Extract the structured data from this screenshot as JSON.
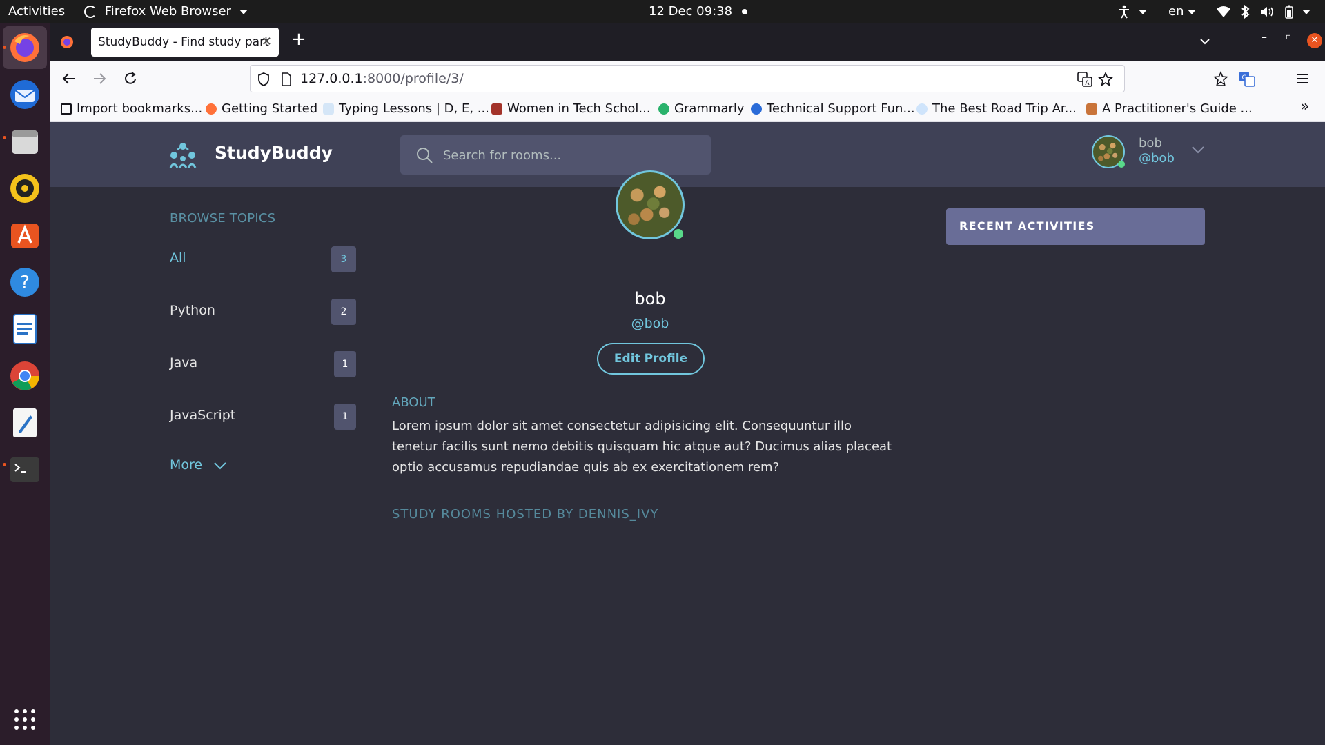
{
  "system_bar": {
    "activities": "Activities",
    "app_menu": "Firefox Web Browser",
    "clock": "12 Dec  09:38",
    "language": "en"
  },
  "browser": {
    "tab_title": "StudyBuddy - Find study part",
    "url_host": "127.0.0.1",
    "url_path": ":8000/profile/3/",
    "bookmarks": [
      {
        "label": "Import bookmarks...",
        "icon": "import-icon"
      },
      {
        "label": "Getting Started",
        "icon": "firefox-icon"
      },
      {
        "label": "Typing Lessons | D, E, ...",
        "icon": "typing-icon"
      },
      {
        "label": "Women in Tech Schol...",
        "icon": "shield-icon"
      },
      {
        "label": "Grammarly",
        "icon": "grammarly-icon"
      },
      {
        "label": "Technical Support Fun...",
        "icon": "c-icon"
      },
      {
        "label": "The Best Road Trip Ar...",
        "icon": "wifi-icon"
      },
      {
        "label": "A Practitioner's Guide ...",
        "icon": "person-icon"
      }
    ]
  },
  "app": {
    "brand": "StudyBuddy",
    "search_placeholder": "Search for rooms...",
    "user": {
      "name": "bob",
      "handle": "@bob"
    }
  },
  "sidebar": {
    "title": "BROWSE TOPICS",
    "topics": [
      {
        "label": "All",
        "count": "3"
      },
      {
        "label": "Python",
        "count": "2"
      },
      {
        "label": "Java",
        "count": "1"
      },
      {
        "label": "JavaScript",
        "count": "1"
      }
    ],
    "more": "More"
  },
  "profile": {
    "name": "bob",
    "handle": "@bob",
    "edit_label": "Edit Profile",
    "about_title": "ABOUT",
    "about_text": "Lorem ipsum dolor sit amet consectetur adipisicing elit. Consequuntur illo tenetur facilis sunt nemo debitis quisquam hic atque aut? Ducimus alias placeat optio accusamus repudiandae quis ab ex exercitationem rem?",
    "hosted_title": "STUDY ROOMS HOSTED BY DENNIS_IVY"
  },
  "activity": {
    "title": "RECENT ACTIVITIES"
  },
  "colors": {
    "accent": "#71c6dd",
    "header": "#3f4156",
    "background": "#2d2d39",
    "card": "#696d97"
  }
}
